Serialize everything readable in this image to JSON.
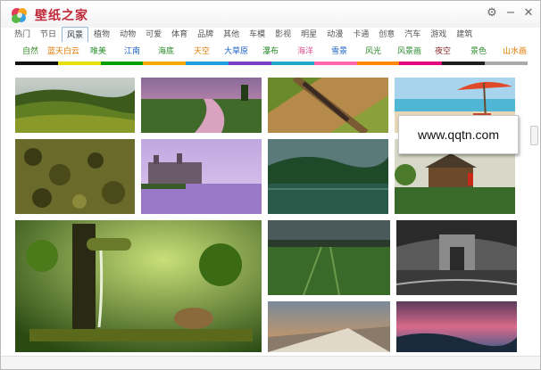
{
  "app": {
    "title": "壁纸之家"
  },
  "window_controls": {
    "settings_glyph": "⚙",
    "minimize_glyph": "−",
    "close_glyph": "✕"
  },
  "categories": [
    {
      "label": "热门"
    },
    {
      "label": "节日"
    },
    {
      "label": "风景",
      "active": true
    },
    {
      "label": "植物"
    },
    {
      "label": "动物"
    },
    {
      "label": "可爱"
    },
    {
      "label": "体育"
    },
    {
      "label": "品牌"
    },
    {
      "label": "其他"
    },
    {
      "label": "车模"
    },
    {
      "label": "影视"
    },
    {
      "label": "明星"
    },
    {
      "label": "动漫"
    },
    {
      "label": "卡通"
    },
    {
      "label": "创意"
    },
    {
      "label": "汽车"
    },
    {
      "label": "游戏"
    },
    {
      "label": "建筑"
    }
  ],
  "subcategories": [
    {
      "label": "自然",
      "color": "#3a8a2c"
    },
    {
      "label": "蓝天白云",
      "color": "#e07a00"
    },
    {
      "label": "唯美",
      "color": "#2f8f2f"
    },
    {
      "label": "江南",
      "color": "#1c63c5"
    },
    {
      "label": "海底",
      "color": "#2a8a2a"
    },
    {
      "label": "天空",
      "color": "#e07a00"
    },
    {
      "label": "大草原",
      "color": "#1c63c5"
    },
    {
      "label": "瀑布",
      "color": "#2a8a2a"
    },
    {
      "label": "海洋",
      "color": "#d94f8e"
    },
    {
      "label": "雪景",
      "color": "#1c63c5"
    },
    {
      "label": "风光",
      "color": "#2a8a2a"
    },
    {
      "label": "风景画",
      "color": "#2a8a2a"
    },
    {
      "label": "夜空",
      "color": "#8a2a2a"
    },
    {
      "label": "景色",
      "color": "#2a8a2a"
    },
    {
      "label": "山水画",
      "color": "#e07a00"
    }
  ],
  "color_strip": [
    "#111111",
    "#e8e000",
    "#00a000",
    "#f5a800",
    "#1f9ee0",
    "#7a3fc4",
    "#22a8c9",
    "#ff66aa",
    "#ff8800",
    "#e6007e",
    "#1e1e1e",
    "#aaaaaa"
  ],
  "watermark": {
    "text": "www.qqtn.com"
  },
  "thumbnails": [
    {
      "name": "green-hills"
    },
    {
      "name": "river-sunset"
    },
    {
      "name": "train-field"
    },
    {
      "name": "beach-umbrella"
    },
    {
      "name": "aerial-trees"
    },
    {
      "name": "castle-lake"
    },
    {
      "name": "forest-lake"
    },
    {
      "name": "village"
    },
    {
      "name": "bamboo-water"
    },
    {
      "name": "grass-storm"
    },
    {
      "name": "arc-de-triomphe"
    },
    {
      "name": "street-sunset"
    },
    {
      "name": "coast-dusk"
    }
  ]
}
